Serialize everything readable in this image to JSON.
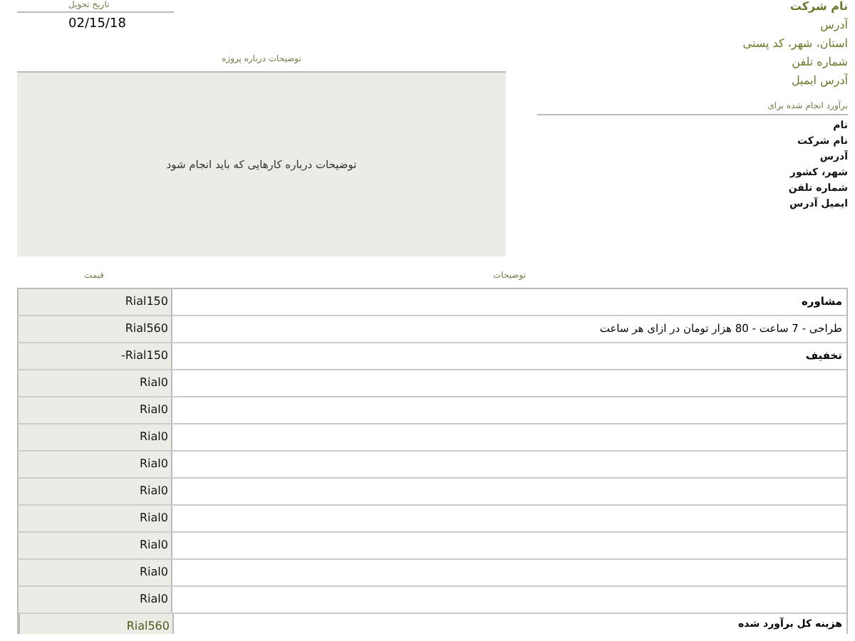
{
  "company": {
    "name": "نام شرکت",
    "lines": [
      "آدرس",
      "استان، شهر، کد پستی",
      "شماره تلفن",
      "آدرس ایمیل"
    ]
  },
  "delivery": {
    "label": "تاریخ تحویل",
    "date": "02/15/18"
  },
  "project": {
    "label": "توضیحات درباره پروژه",
    "text": "توضیحات درباره کارهایی که باید انجام شود"
  },
  "client": {
    "label": "برآورد انجام شده برای",
    "lines": [
      "نام",
      "نام شرکت",
      "آدرس",
      "شهر، کشور",
      "شماره تلفن",
      "ایمیل آدرس"
    ]
  },
  "table": {
    "columns": [
      "توضیحات",
      "قیمت"
    ],
    "rows": [
      {
        "description": "مشاوره",
        "price": "Rial150"
      },
      {
        "description": "طراحی - 7 ساعت - 80 هزار تومان در ازای هر ساعت",
        "price": "Rial560"
      },
      {
        "description": "تخفیف",
        "price": "-Rial150"
      },
      {
        "price": "Rial0"
      },
      {
        "price": "Rial0"
      },
      {
        "price": "Rial0"
      },
      {
        "price": "Rial0"
      },
      {
        "price": "Rial0"
      },
      {
        "price": "Rial0"
      },
      {
        "price": "Rial0"
      },
      {
        "price": "Rial0"
      },
      {
        "price": "Rial0"
      }
    ],
    "total": {
      "label": "هزینه کل برآورد شده",
      "price": "Rial560"
    }
  }
}
